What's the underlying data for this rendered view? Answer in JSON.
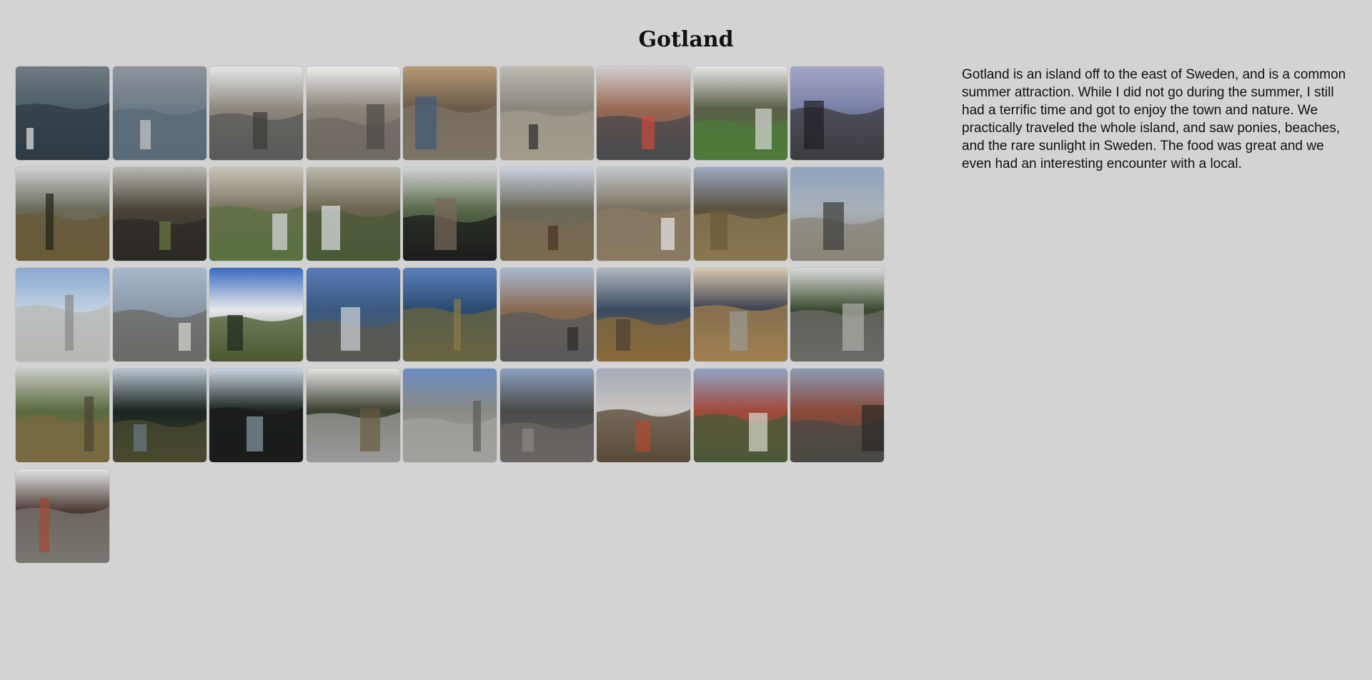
{
  "page": {
    "title": "Gotland",
    "description": "Gotland is an island off to the east of Sweden, and is a common summer attraction. While I did not go during the summer, I still had a terrific time and got to enjoy the town and nature. We practically traveled the whole island, and saw ponies, beaches, and the rare sunlight in Sweden. The food was great and we even had an interesting encounter with a local."
  },
  "colors": {
    "background": "#d3d3d3",
    "text": "#111111"
  },
  "gallery": {
    "photos": [
      {
        "sky": "#6f7a82",
        "mid": "#4e5d66",
        "ground": "#2f3b44",
        "accent": "#e8e8e8"
      },
      {
        "sky": "#8d949c",
        "mid": "#6d7a86",
        "ground": "#5a6a78",
        "accent": "#c9c9c9"
      },
      {
        "sky": "#e4e6e8",
        "mid": "#8e887e",
        "ground": "#5a5a58",
        "accent": "#3a3a38"
      },
      {
        "sky": "#ececec",
        "mid": "#8a8378",
        "ground": "#6f6a62",
        "accent": "#4c4a46"
      },
      {
        "sky": "#b49a74",
        "mid": "#6b5a4a",
        "ground": "#7c7466",
        "accent": "#3f5a7a"
      },
      {
        "sky": "#bdbab2",
        "mid": "#8a867c",
        "ground": "#a29b8e",
        "accent": "#2a2a2a"
      },
      {
        "sky": "#d0d0d0",
        "mid": "#9a6a56",
        "ground": "#4a4a4c",
        "accent": "#c94a3a"
      },
      {
        "sky": "#e6e6e6",
        "mid": "#5a6048",
        "ground": "#4e7a3a",
        "accent": "#d8d8d8"
      },
      {
        "sky": "#a4a6c8",
        "mid": "#7a80a6",
        "ground": "#3e3c40",
        "accent": "#1e1e24"
      },
      {
        "sky": "#cfd0d0",
        "mid": "#6a6a5a",
        "ground": "#6a5a38",
        "accent": "#1e241a"
      },
      {
        "sky": "#b8b8b0",
        "mid": "#4a4438",
        "ground": "#2c2a26",
        "accent": "#6a7a40"
      },
      {
        "sky": "#c8c4b8",
        "mid": "#7a7260",
        "ground": "#5a7040",
        "accent": "#d8dce0"
      },
      {
        "sky": "#bcb8ac",
        "mid": "#6a6450",
        "ground": "#4a5a38",
        "accent": "#e0e4e8"
      },
      {
        "sky": "#d0d4d6",
        "mid": "#5a6a4a",
        "ground": "#1c1e1c",
        "accent": "#7a6a5a"
      },
      {
        "sky": "#c8d0e0",
        "mid": "#6a6858",
        "ground": "#7a6a50",
        "accent": "#4a3020"
      },
      {
        "sky": "#c4c8cc",
        "mid": "#7a7060",
        "ground": "#8a7a62",
        "accent": "#e8e8e8"
      },
      {
        "sky": "#9aa8c0",
        "mid": "#5a5240",
        "ground": "#8a7650",
        "accent": "#6a5838"
      },
      {
        "sky": "#8ea4c0",
        "mid": "#a8b0b8",
        "ground": "#8a8478",
        "accent": "#3a3c3a"
      },
      {
        "sky": "#8aa8d0",
        "mid": "#c0d0e0",
        "ground": "#b8b8b4",
        "accent": "#8a8a88"
      },
      {
        "sky": "#a8b8cc",
        "mid": "#8a98a8",
        "ground": "#6a6a66",
        "accent": "#d8d8d4"
      },
      {
        "sky": "#3a6ac0",
        "mid": "#e8e8ec",
        "ground": "#4a5a30",
        "accent": "#1a2a1a"
      },
      {
        "sky": "#5a7ab8",
        "mid": "#3a5a80",
        "ground": "#5a5a50",
        "accent": "#d0d4d8"
      },
      {
        "sky": "#5a80b8",
        "mid": "#2a4a70",
        "ground": "#6a6440",
        "accent": "#8a7a4a"
      },
      {
        "sky": "#a8b8d0",
        "mid": "#8a6a50",
        "ground": "#5a5a5a",
        "accent": "#2a2a2a"
      },
      {
        "sky": "#b0b8c0",
        "mid": "#3a4a60",
        "ground": "#8a6a3a",
        "accent": "#4a4030"
      },
      {
        "sky": "#d8c8b0",
        "mid": "#3a4050",
        "ground": "#a08050",
        "accent": "#9a9a94"
      },
      {
        "sky": "#d8dcd8",
        "mid": "#3a4a30",
        "ground": "#6a6a66",
        "accent": "#b0b0aa"
      },
      {
        "sky": "#c8ccc8",
        "mid": "#5a6a40",
        "ground": "#7a6a40",
        "accent": "#4a4434"
      },
      {
        "sky": "#b8c4d0",
        "mid": "#1a2420",
        "ground": "#4a4a30",
        "accent": "#6a7a88"
      },
      {
        "sky": "#c8d4e0",
        "mid": "#1c2420",
        "ground": "#1a1c1a",
        "accent": "#8a9aa8"
      },
      {
        "sky": "#e4e4e2",
        "mid": "#3a4030",
        "ground": "#9a9a98",
        "accent": "#6a5a40"
      },
      {
        "sky": "#6a8cc0",
        "mid": "#8a8a86",
        "ground": "#a0a09c",
        "accent": "#5a5a56"
      },
      {
        "sky": "#8aa0c0",
        "mid": "#4a4a48",
        "ground": "#6a6664",
        "accent": "#8a8684"
      },
      {
        "sky": "#a4aab8",
        "mid": "#c8c4c0",
        "ground": "#5a4a38",
        "accent": "#b04a30"
      },
      {
        "sky": "#90a4c4",
        "mid": "#a04a3a",
        "ground": "#4a5a38",
        "accent": "#d8d8d0"
      },
      {
        "sky": "#8a9ab4",
        "mid": "#8a4a3a",
        "ground": "#4a4a44",
        "accent": "#2a2a28"
      },
      {
        "sky": "#e0e2e4",
        "mid": "#4a3a30",
        "ground": "#7a7670",
        "accent": "#a04a38"
      }
    ]
  }
}
